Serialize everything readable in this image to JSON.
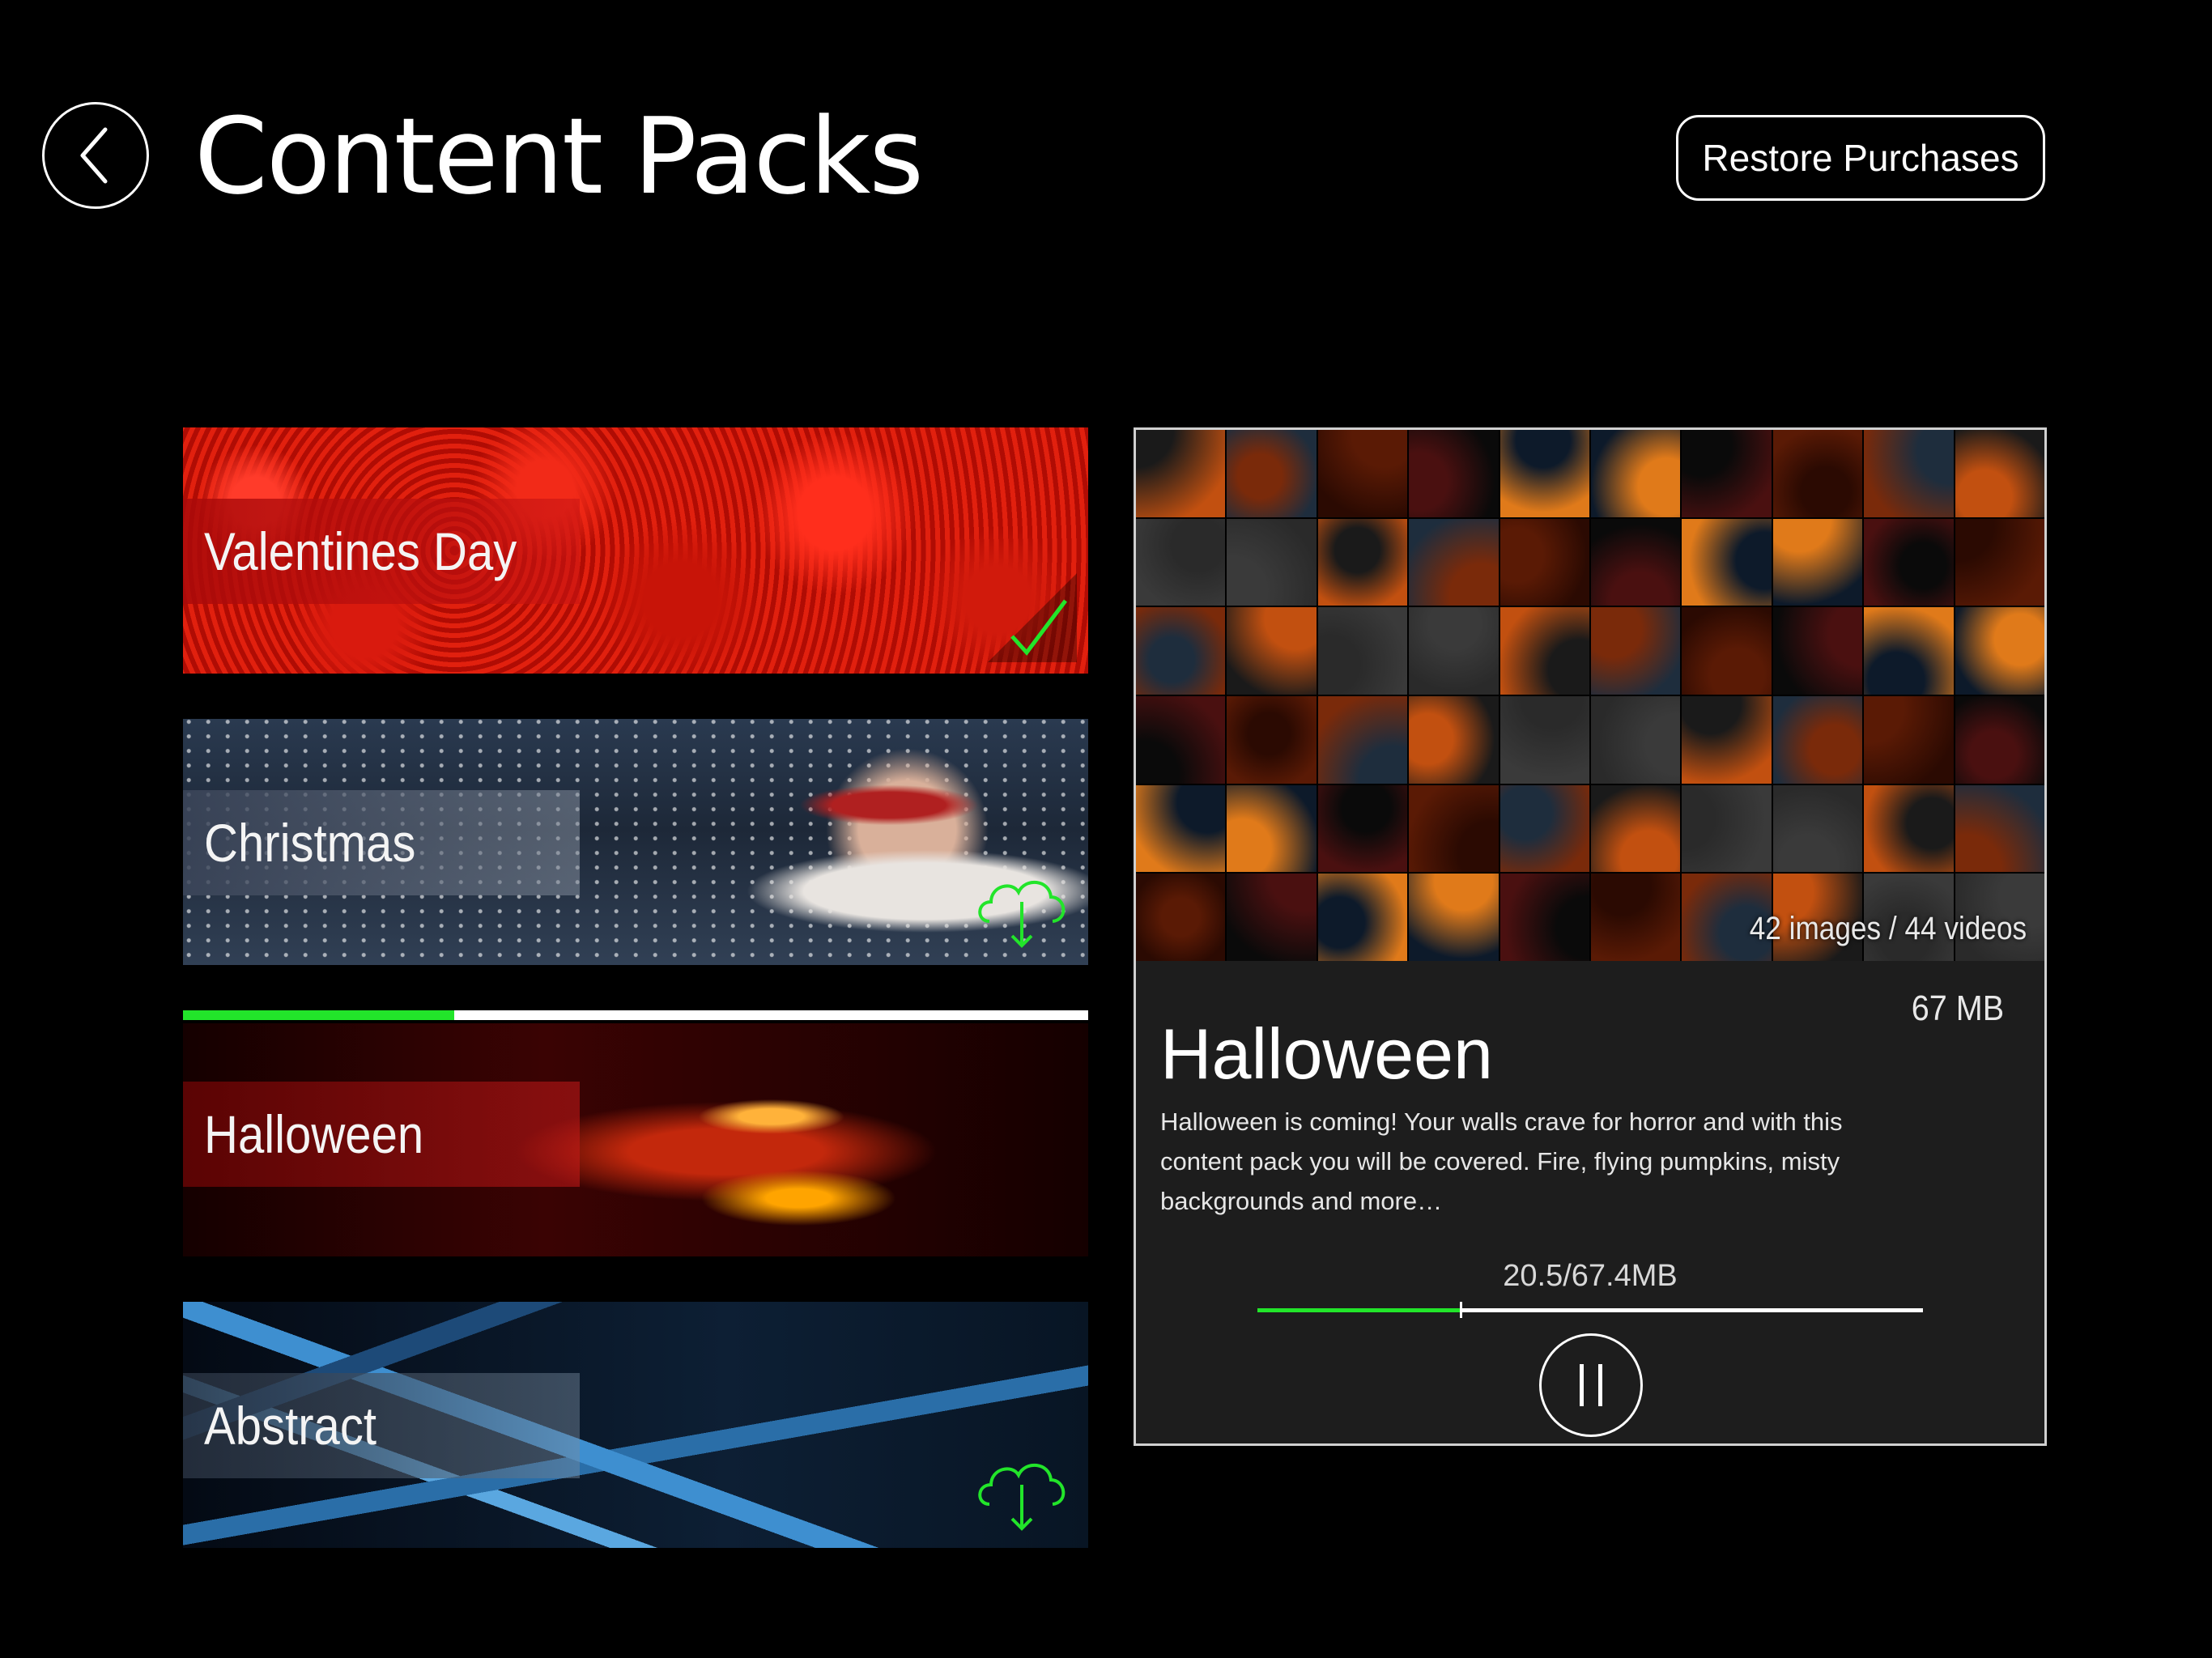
{
  "header": {
    "title": "Content Packs",
    "restore_label": "Restore Purchases",
    "back_icon": "chevron-left-icon"
  },
  "packs": [
    {
      "id": "valentines",
      "label": "Valentines Day",
      "status": "installed",
      "status_icon": "checkmark-icon"
    },
    {
      "id": "christmas",
      "label": "Christmas",
      "status": "available",
      "status_icon": "cloud-download-icon"
    },
    {
      "id": "halloween",
      "label": "Halloween",
      "status": "downloading",
      "progress": 0.3
    },
    {
      "id": "abstract",
      "label": "Abstract",
      "status": "available",
      "status_icon": "cloud-download-icon"
    }
  ],
  "detail": {
    "media_count": "42 images / 44 videos",
    "size": "67 MB",
    "title": "Halloween",
    "description": "Halloween is coming! Your walls crave for horror and with this content pack you will be covered. Fire, flying pumpkins, misty backgrounds and more…",
    "download_text": "20.5/67.4MB",
    "download_progress": 0.304,
    "pause_icon": "pause-icon"
  },
  "colors": {
    "accent_green": "#22e52a",
    "background": "#000000",
    "card_background": "#1d1d1d"
  }
}
